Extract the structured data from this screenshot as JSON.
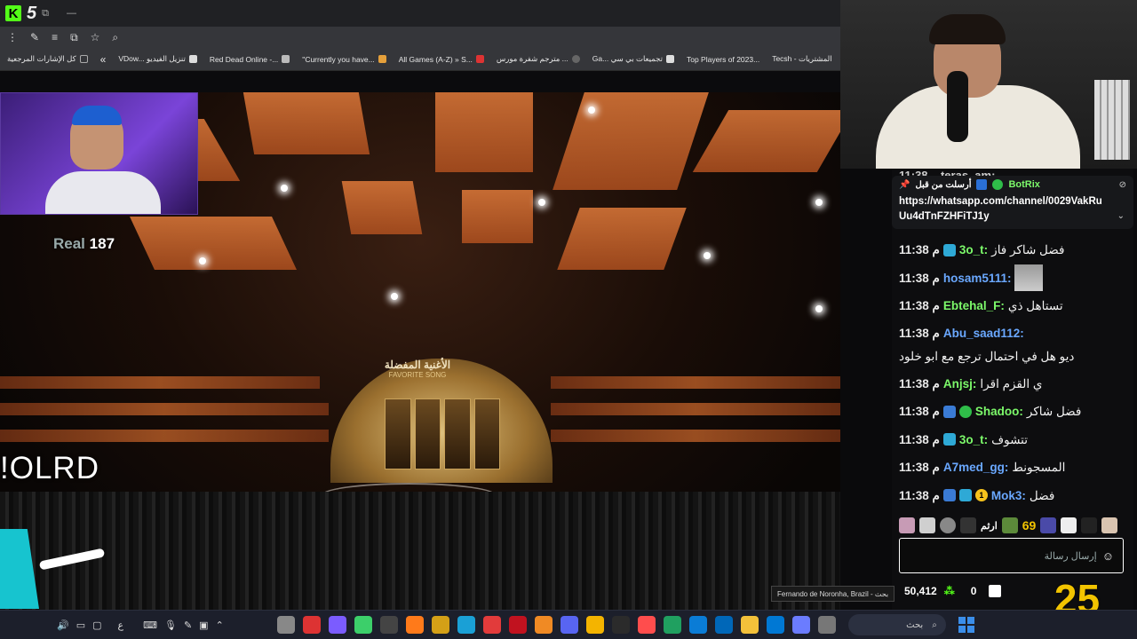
{
  "browser": {
    "tab_count": "5",
    "app_logo": "K",
    "bookmarks": [
      {
        "label": "كل الإشارات المرجعية",
        "color": "#888"
      },
      {
        "label": "VDow... تنزيل الفيديو",
        "color": "#ddd"
      },
      {
        "label": "Red Dead Online -...",
        "color": "#ccc"
      },
      {
        "label": "\"Currently you have...",
        "color": "#e5a03b"
      },
      {
        "label": "All Games (A-Z) » S...",
        "color": "#d33"
      },
      {
        "label": "مترجم شفرة مورس ...",
        "color": "#666"
      },
      {
        "label": "Ga... تجميعات بي سي",
        "color": "#ddd"
      },
      {
        "label": "Top Players of 2023...",
        "color": "#4aa"
      },
      {
        "label": "Tecsh - المشتريات",
        "color": "#777"
      }
    ]
  },
  "stream": {
    "small_cam_label": "Real",
    "small_cam_number": "187",
    "stage_sign_ar": "الأغنية المفضلة",
    "stage_sign_en": "FAVORITE SONG",
    "overlay_text": "!OLRD"
  },
  "chat": {
    "top_partial": "11:38 ...teras_am:",
    "pinned": {
      "meta": "أرسلت من قبل",
      "user": "BotRix",
      "url": "https://whatsapp.com/channel/0029VakRuUu4dTnFZHFiTJ1y"
    },
    "messages": [
      {
        "time": "11:38 م",
        "user": "3o_t:",
        "color": "#7cf96a",
        "badges": [
          "sub"
        ],
        "text": "فضل شاكر فاز"
      },
      {
        "time": "11:38 م",
        "user": "hosam5111:",
        "color": "#6aa8ff",
        "badges": [],
        "text": "",
        "image": true
      },
      {
        "time": "11:38 م",
        "user": "Ebtehal_F:",
        "color": "#7cf96a",
        "badges": [],
        "text": "تستاهل ذي"
      },
      {
        "time": "11:38 م",
        "user": "Abu_saad112:",
        "color": "#6aa8ff",
        "badges": [],
        "text": "ديو هل في احتمال ترجع مع ابو خلود",
        "tall": true
      },
      {
        "time": "11:38 م",
        "user": "Anjsj:",
        "color": "#7cf96a",
        "badges": [],
        "text": "ي القزم اقرا"
      },
      {
        "time": "11:38 م",
        "user": "Shadoo:",
        "color": "#7cf96a",
        "badges": [
          "mod",
          "ver"
        ],
        "text": "فضل شاكر"
      },
      {
        "time": "11:38 م",
        "user": "3o_t:",
        "color": "#7cf96a",
        "badges": [
          "sub"
        ],
        "text": "تتشوف"
      },
      {
        "time": "11:38 م",
        "user": "A7med_gg:",
        "color": "#6aa8ff",
        "badges": [],
        "text": "المسجونط"
      },
      {
        "time": "11:38 م",
        "user": "Mok3:",
        "color": "#6aa8ff",
        "badges": [
          "mod",
          "sub",
          "num"
        ],
        "text": "فضل"
      }
    ],
    "emote_text_1": "69",
    "emote_text_2": "ارثم",
    "input_placeholder": "إرسال رسالة",
    "points": "50,412",
    "viewers": "0",
    "logo_text": "25"
  },
  "taskbar": {
    "search_label": "بحث",
    "tooltip": "Fernando de Noronha, Brazil - بحث",
    "lang": "ع",
    "apps": [
      "#888",
      "#d33",
      "#7b5cff",
      "#3ccf6a",
      "#444",
      "#ff7a1a",
      "#d4a017",
      "#1aa0d6",
      "#e23b3b",
      "#c1121f",
      "#f08a24",
      "#5865f2",
      "#f4b400",
      "#2b2b2b",
      "#ff4d4d",
      "#20a060",
      "#0a7cd6",
      "#0067b8",
      "#f3c13a",
      "#0078d4",
      "#6b7cff",
      "#777"
    ]
  }
}
